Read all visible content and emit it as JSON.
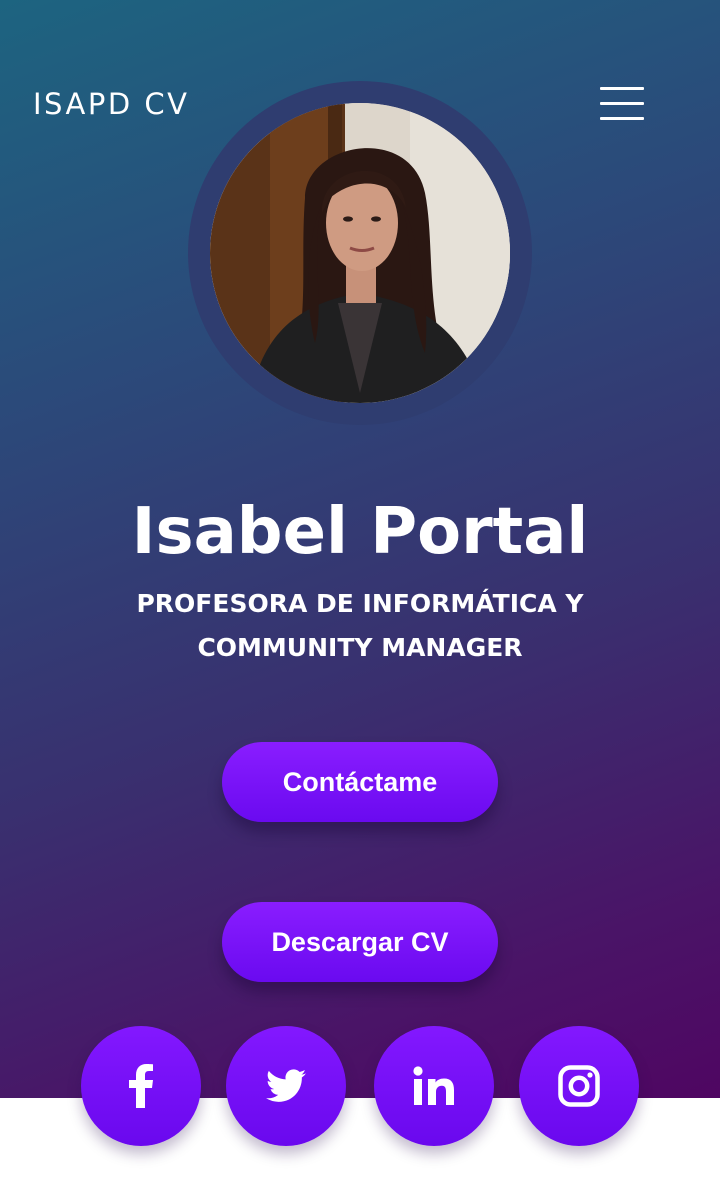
{
  "header": {
    "brand": "ISAPD CV",
    "menu_icon": "hamburger-menu-icon"
  },
  "profile": {
    "photo_icon": "profile-photo",
    "name": "Isabel Portal",
    "role_line1": "PROFESORA DE INFORMÁTICA Y",
    "role_line2": "COMMUNITY MANAGER"
  },
  "actions": {
    "contact_label": "Contáctame",
    "download_label": "Descargar CV"
  },
  "social": [
    {
      "network": "facebook",
      "icon": "facebook-icon"
    },
    {
      "network": "twitter",
      "icon": "twitter-icon"
    },
    {
      "network": "linkedin",
      "icon": "linkedin-icon"
    },
    {
      "network": "instagram",
      "icon": "instagram-icon"
    }
  ],
  "colors": {
    "gradient_start": "#1d6480",
    "gradient_end": "#4f0662",
    "accent": "#7a12f8",
    "text": "#ffffff",
    "footer_bg": "#ffffff"
  }
}
